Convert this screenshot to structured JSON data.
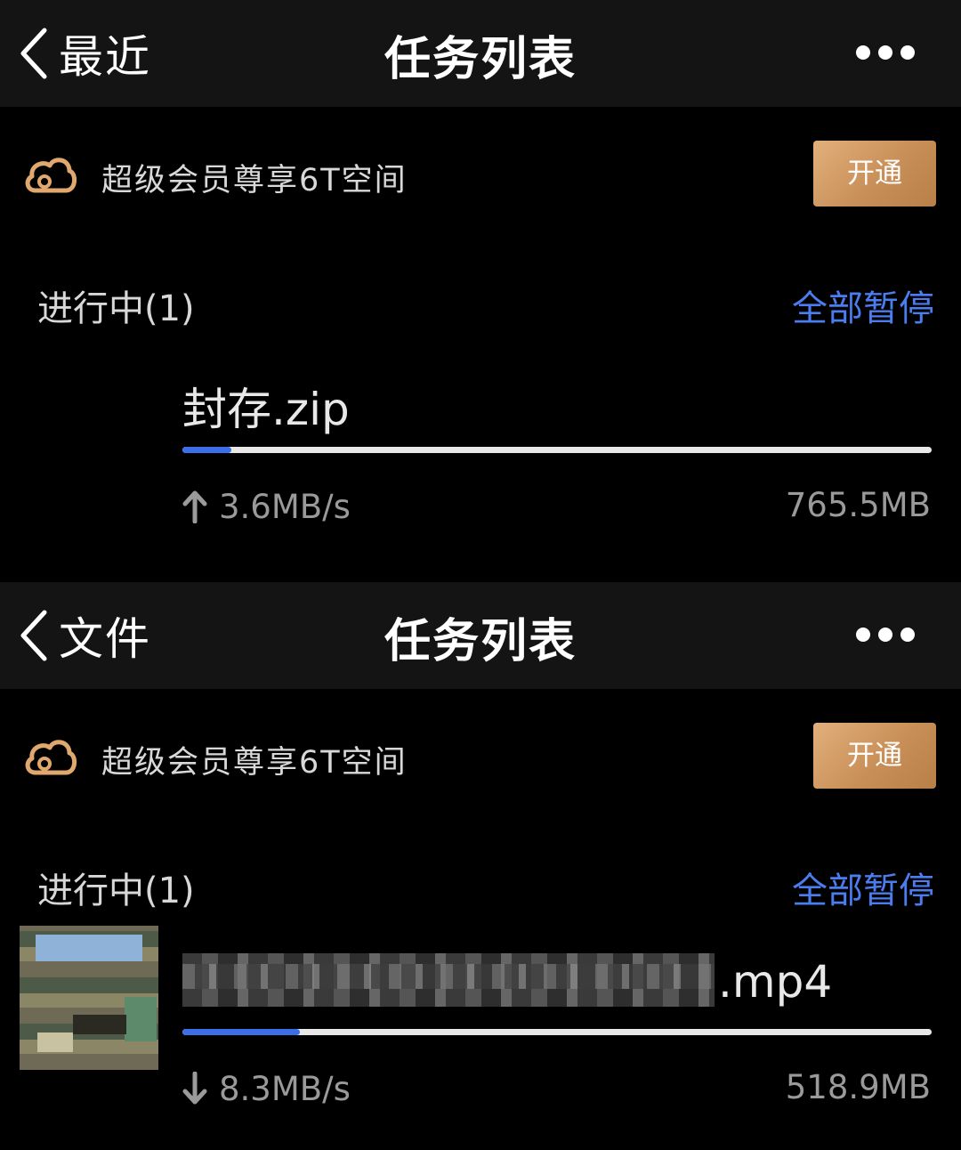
{
  "screens": [
    {
      "nav": {
        "back_label": "最近",
        "title": "任务列表"
      },
      "promo": {
        "text": "超级会员尊享6T空间",
        "button": "开通"
      },
      "section": {
        "label": "进行中(1)",
        "action": "全部暂停"
      },
      "task": {
        "file_name": "封存.zip",
        "direction": "upload",
        "speed": "3.6MB/s",
        "size": "765.5MB",
        "progress_fraction": 0.065
      }
    },
    {
      "nav": {
        "back_label": "文件",
        "title": "任务列表"
      },
      "promo": {
        "text": "超级会员尊享6T空间",
        "button": "开通"
      },
      "section": {
        "label": "进行中(1)",
        "action": "全部暂停"
      },
      "task": {
        "file_name_visible_suffix": ".mp4",
        "direction": "download",
        "speed": "8.3MB/s",
        "size": "518.9MB",
        "progress_fraction": 0.157
      }
    }
  ],
  "colors": {
    "accent_blue": "#3a6fe8",
    "link_blue": "#4a7df0",
    "gold_button": "#d9a46d",
    "cloud_icon": "#e0a86e"
  },
  "icons": {
    "back": "chevron-left-icon",
    "more": "more-dots-icon",
    "cloud": "cloud-icon",
    "upload": "arrow-up-icon",
    "download": "arrow-down-icon"
  }
}
